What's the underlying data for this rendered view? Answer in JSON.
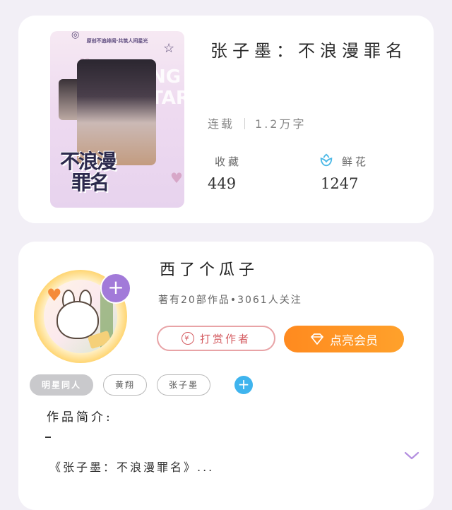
{
  "book": {
    "title": "张子墨：不浪漫罪名",
    "status": "连载",
    "word_count": "1.2万字",
    "favorites_label": "收藏",
    "favorites_value": "449",
    "flowers_label": "鲜花",
    "flowers_value": "1247",
    "cover_art": {
      "banner": "原创不追绯闻·共筑人间星光",
      "title_line1": "不浪漫",
      "title_line2": "罪名",
      "background_word": "NG TAR"
    }
  },
  "author": {
    "name": "西了个瓜子",
    "stats": "著有20部作品•3061人关注",
    "follow_symbol": "+",
    "tip_label": "打赏作者",
    "tip_icon_glyph": "¥",
    "vip_label": "点亮会员"
  },
  "tags": [
    "明星同人",
    "黄翔",
    "张子墨"
  ],
  "tag_add_symbol": "+",
  "intro": {
    "label": "作品简介:",
    "text": "《张子墨：不浪漫罪名》..."
  },
  "colors": {
    "accent_orange": "#ff8a1f",
    "tip_red": "#d45b60",
    "follow_purple": "#a27ad9",
    "tag_add_blue": "#3fb4ee",
    "flower_blue": "#4bb8e6"
  },
  "icons": {
    "flower": "flower-icon",
    "diamond": "diamond-icon",
    "coin": "coin-icon",
    "expand": "chevron-down-icon"
  }
}
